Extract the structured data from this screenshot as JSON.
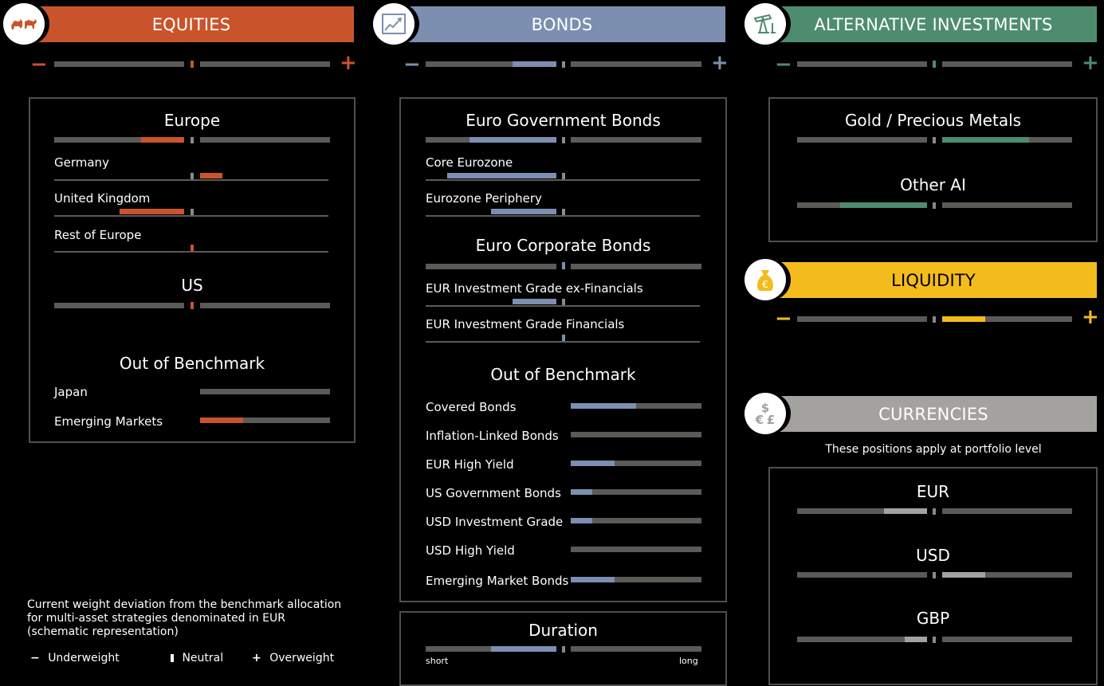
{
  "colors": {
    "equities": "#c9542c",
    "bonds": "#7c8fb0",
    "alt": "#4e8c70",
    "liquidity": "#f4bb1c",
    "currencies": "#a3a29e",
    "track": "#5a5a57"
  },
  "headers": {
    "equities": "EQUITIES",
    "bonds": "BONDS",
    "alt": "ALTERNATIVE INVESTMENTS",
    "liquidity": "LIQUIDITY",
    "currencies": "CURRENCIES"
  },
  "icons": {
    "equities": "bull-bear-icon",
    "bonds": "growth-chart-icon",
    "alt": "oil-pump-icon",
    "liquidity": "money-bag-icon",
    "currencies": "currency-symbols-icon"
  },
  "signs": {
    "minus": "−",
    "plus": "+"
  },
  "equities": {
    "europe_title": "Europe",
    "germany": "Germany",
    "uk": "United Kingdom",
    "rest": "Rest of Europe",
    "us_title": "US",
    "oob_title": "Out of Benchmark",
    "japan": "Japan",
    "em": "Emerging Markets"
  },
  "bonds": {
    "egb_title": "Euro Government Bonds",
    "core": "Core Eurozone",
    "periphery": "Eurozone Periphery",
    "corp_title": "Euro Corporate Bonds",
    "ig_exfin": "EUR Investment Grade ex-Financials",
    "ig_fin": "EUR Investment Grade Financials",
    "oob_title": "Out of Benchmark",
    "oob_items": [
      "Covered Bonds",
      "Inflation-Linked Bonds",
      "EUR High Yield",
      "US Government Bonds",
      "USD Investment Grade",
      "USD High Yield",
      "Emerging Market Bonds"
    ],
    "duration_title": "Duration",
    "short": "short",
    "long": "long"
  },
  "alt": {
    "gold": "Gold / Precious Metals",
    "other": "Other AI"
  },
  "currencies": {
    "note": "These positions apply at portfolio level",
    "eur": "EUR",
    "usd": "USD",
    "gbp": "GBP"
  },
  "legend": {
    "line1": "Current weight deviation from the benchmark allocation",
    "line2": "for multi-asset strategies denominated in EUR",
    "line3": "(schematic representation)",
    "under": "Underweight",
    "neutral": "Neutral",
    "over": "Overweight"
  }
}
